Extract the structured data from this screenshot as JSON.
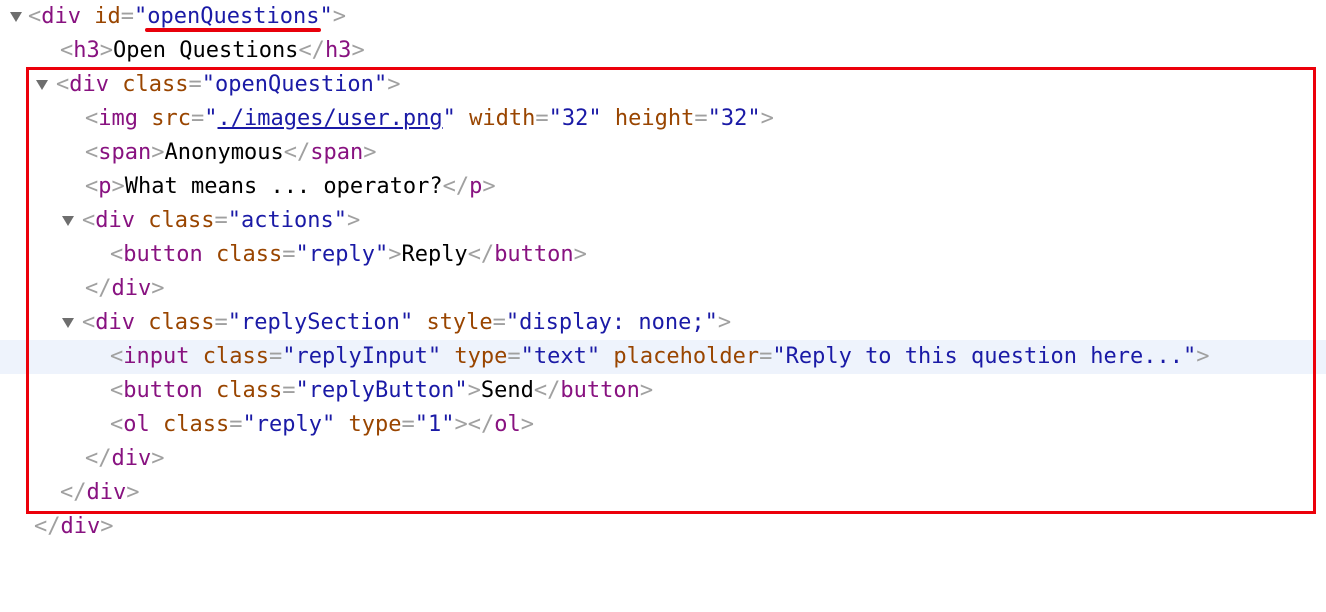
{
  "dom_tree": {
    "l1": {
      "tag": "div",
      "attr_id_name": "id",
      "attr_id_value": "openQuestions"
    },
    "l2": {
      "tag": "h3",
      "text": "Open Questions"
    },
    "l3": {
      "tag": "div",
      "attr_name": "class",
      "attr_value": "openQuestion"
    },
    "l4": {
      "tag": "img",
      "a1n": "src",
      "a1v": "./images/user.png",
      "a2n": "width",
      "a2v": "32",
      "a3n": "height",
      "a3v": "32"
    },
    "l5": {
      "tag": "span",
      "text": "Anonymous"
    },
    "l6": {
      "tag": "p",
      "text": "What means ... operator?"
    },
    "l7": {
      "tag": "div",
      "attr_name": "class",
      "attr_value": "actions"
    },
    "l8": {
      "tag": "button",
      "attr_name": "class",
      "attr_value": "reply",
      "text": "Reply"
    },
    "l9": {
      "tag": "div"
    },
    "l10": {
      "tag": "div",
      "a1n": "class",
      "a1v": "replySection",
      "a2n": "style",
      "a2v": "display: none;"
    },
    "l11": {
      "tag": "input",
      "a1n": "class",
      "a1v": "replyInput",
      "a2n": "type",
      "a2v": "text",
      "a3n": "placeholder",
      "a3v": "Reply to this question here..."
    },
    "l12": {
      "tag": "button",
      "attr_name": "class",
      "attr_value": "replyButton",
      "text": "Send"
    },
    "l13": {
      "tag": "ol",
      "a1n": "class",
      "a1v": "reply",
      "a2n": "type",
      "a2v": "1"
    },
    "l14": {
      "tag": "div"
    },
    "l15": {
      "tag": "div"
    },
    "l16": {
      "tag": "div"
    }
  },
  "colors": {
    "tag": "#881280",
    "attribute_name": "#994500",
    "attribute_value": "#1a1aa6",
    "bracket": "#a0a0a0",
    "highlight_row": "#eef3fc",
    "annotation_red": "#ec000a"
  }
}
